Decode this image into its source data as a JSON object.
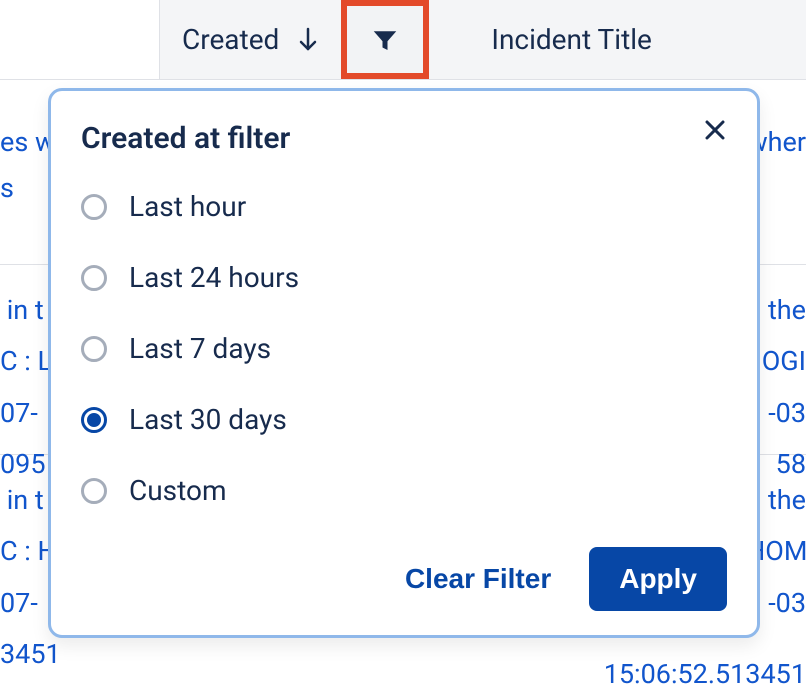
{
  "header": {
    "created_label": "Created",
    "incident_label": "Incident Title"
  },
  "popover": {
    "title": "Created at filter",
    "options": [
      {
        "label": "Last hour",
        "selected": false
      },
      {
        "label": "Last 24 hours",
        "selected": false
      },
      {
        "label": "Last 7 days",
        "selected": false
      },
      {
        "label": "Last 30 days",
        "selected": true
      },
      {
        "label": "Custom",
        "selected": false
      }
    ],
    "clear_label": "Clear Filter",
    "apply_label": "Apply"
  },
  "background": {
    "row1_left": "es w\ns",
    "row1_right": "wher\n",
    "row2_left": " in t\nC : L\n07-\n095",
    "row2_right": "the\nOGI\n-03\n58",
    "row3_left": " in t\nC : H\n07-\n3451",
    "row3_right": "the\nHOM\n-03\n",
    "bottom_time_left": "3451",
    "bottom_time_right": "15:06:52.513451"
  }
}
